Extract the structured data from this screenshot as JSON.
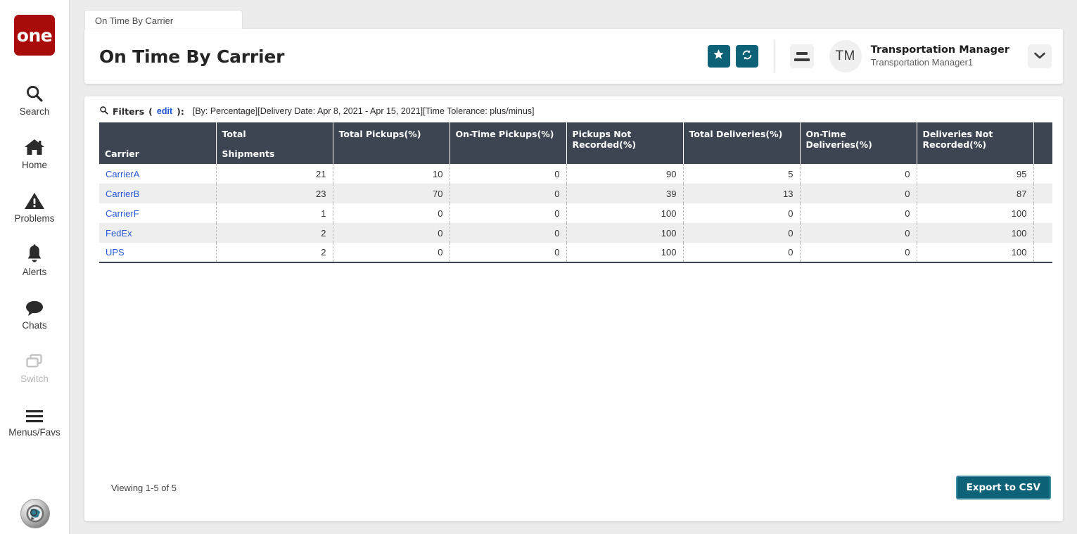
{
  "brand": {
    "logo_text": "one",
    "logo_color": "#a90b0b"
  },
  "theme": {
    "accent": "#0d6277",
    "header_row": "#3d4552",
    "link": "#2a5bd7",
    "stripe": "#eeeeee"
  },
  "sidebar": {
    "items": [
      {
        "label": "Search",
        "icon": "search-icon",
        "disabled": false
      },
      {
        "label": "Home",
        "icon": "home-icon",
        "disabled": false
      },
      {
        "label": "Problems",
        "icon": "warning-triangle-icon",
        "disabled": false
      },
      {
        "label": "Alerts",
        "icon": "bell-icon",
        "disabled": false
      },
      {
        "label": "Chats",
        "icon": "chat-bubble-icon",
        "disabled": false
      },
      {
        "label": "Switch",
        "icon": "switch-windows-icon",
        "disabled": true
      },
      {
        "label": "Menus/Favs",
        "icon": "hamburger-icon",
        "disabled": false
      }
    ],
    "bottom_badge": "globe-avatar-icon"
  },
  "tabs": [
    {
      "label": "On Time By Carrier",
      "active": true
    }
  ],
  "header": {
    "title": "On Time By Carrier",
    "favorite_icon": "star-icon",
    "refresh_icon": "refresh-icon",
    "menu_icon": "list-menu-icon",
    "avatar_initials": "TM",
    "user_name": "Transportation Manager",
    "user_subtitle": "Transportation Manager1",
    "caret_icon": "chevron-down-icon"
  },
  "filters": {
    "search_icon": "search-icon",
    "label": "Filters",
    "edit_label": "edit",
    "open_paren": "(",
    "close_paren": "):",
    "value": "[By: Percentage][Delivery Date: Apr 8, 2021 - Apr 15, 2021][Time Tolerance: plus/minus]"
  },
  "table": {
    "columns": [
      {
        "line1": "Carrier",
        "line2": "",
        "align": "bottom"
      },
      {
        "line1": "Total",
        "line2": "Shipments",
        "align": "top"
      },
      {
        "line1": "Total Pickups(%)",
        "line2": "",
        "align": "top"
      },
      {
        "line1": "On-Time Pickups(%)",
        "line2": "",
        "align": "top"
      },
      {
        "line1": "Pickups Not Recorded(%)",
        "line2": "",
        "align": "top"
      },
      {
        "line1": "Total Deliveries(%)",
        "line2": "",
        "align": "top"
      },
      {
        "line1": "On-Time Deliveries(%)",
        "line2": "",
        "align": "top"
      },
      {
        "line1": "Deliveries Not Recorded(%)",
        "line2": "",
        "align": "top"
      },
      {
        "line1": "",
        "line2": "",
        "align": "top"
      }
    ],
    "rows": [
      {
        "carrier": "CarrierA",
        "total_shipments": "21",
        "total_pickups": "10",
        "on_time_pickups": "0",
        "pickups_not_recorded": "90",
        "total_deliveries": "5",
        "on_time_deliveries": "0",
        "deliveries_not_recorded": "95"
      },
      {
        "carrier": "CarrierB",
        "total_shipments": "23",
        "total_pickups": "70",
        "on_time_pickups": "0",
        "pickups_not_recorded": "39",
        "total_deliveries": "13",
        "on_time_deliveries": "0",
        "deliveries_not_recorded": "87"
      },
      {
        "carrier": "CarrierF",
        "total_shipments": "1",
        "total_pickups": "0",
        "on_time_pickups": "0",
        "pickups_not_recorded": "100",
        "total_deliveries": "0",
        "on_time_deliveries": "0",
        "deliveries_not_recorded": "100"
      },
      {
        "carrier": "FedEx",
        "total_shipments": "2",
        "total_pickups": "0",
        "on_time_pickups": "0",
        "pickups_not_recorded": "100",
        "total_deliveries": "0",
        "on_time_deliveries": "0",
        "deliveries_not_recorded": "100"
      },
      {
        "carrier": "UPS",
        "total_shipments": "2",
        "total_pickups": "0",
        "on_time_pickups": "0",
        "pickups_not_recorded": "100",
        "total_deliveries": "0",
        "on_time_deliveries": "0",
        "deliveries_not_recorded": "100"
      }
    ]
  },
  "footer": {
    "viewing": "Viewing 1-5 of 5",
    "export_label": "Export to CSV"
  }
}
